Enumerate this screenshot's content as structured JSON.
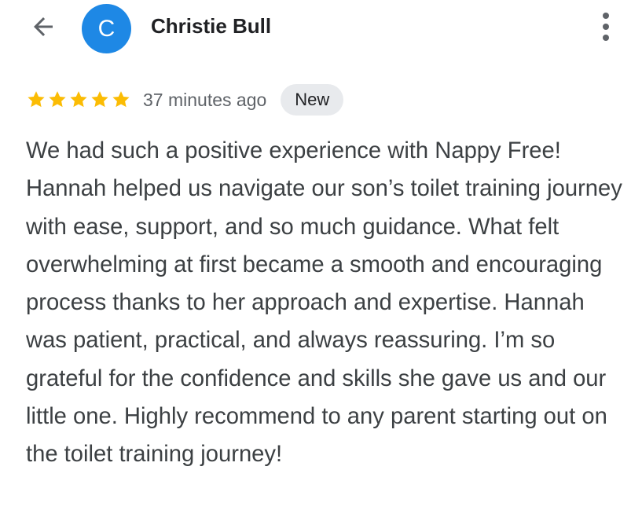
{
  "header": {
    "back_icon": "arrow-left-icon",
    "avatar_letter": "C",
    "avatar_color": "#1e88e5",
    "reviewer_name": "Christie Bull",
    "more_icon": "more-vertical-icon"
  },
  "review": {
    "rating": 5,
    "max_rating": 5,
    "star_color": "#fbbc04",
    "timestamp": "37 minutes ago",
    "badge": "New",
    "text": "We had such a positive experience with Nappy Free! Hannah helped us navigate our son’s toilet training journey with ease, support, and so much guidance. What felt overwhelming at first became a smooth and encouraging process thanks to her approach and expertise. Hannah was patient, practical, and always reassuring. I’m so grateful for the confidence and skills she gave us and our little one. Highly recommend to any parent starting out on the toilet training journey!"
  }
}
